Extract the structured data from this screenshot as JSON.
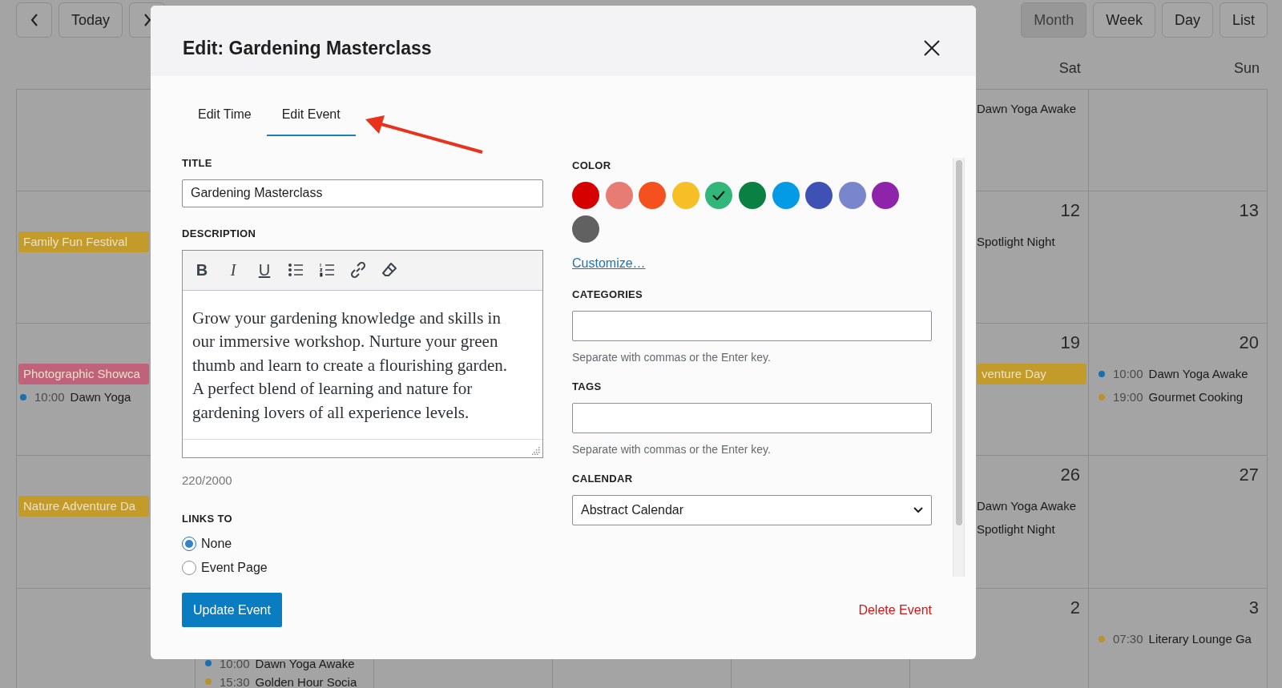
{
  "calendar": {
    "nav_buttons": [
      {
        "kind": "prev"
      },
      {
        "kind": "today",
        "label": "Today"
      },
      {
        "kind": "next"
      }
    ],
    "view_buttons": [
      {
        "label": "Month",
        "selected": true
      },
      {
        "label": "Week",
        "selected": false
      },
      {
        "label": "Day",
        "selected": false
      },
      {
        "label": "List",
        "selected": false
      }
    ],
    "weekday_headers": {
      "sat": "Sat",
      "sun": "Sun"
    },
    "weeks": [
      {
        "sat": {
          "items": [
            {
              "kind": "plain",
              "label": "Dawn Yoga Awake"
            }
          ]
        }
      },
      {
        "mon": {
          "items": [
            {
              "kind": "bar",
              "label": "Family Fun Festival",
              "color": "#c39b2a"
            }
          ]
        },
        "sat": {
          "date": "12",
          "items": [
            {
              "kind": "plain",
              "label": "Spotlight Night"
            }
          ]
        },
        "sun": {
          "date": "13"
        }
      },
      {
        "mon": {
          "items": [
            {
              "kind": "bar",
              "label": "Photographic Showca",
              "color": "#c0627c"
            },
            {
              "kind": "timed",
              "time": "10:00",
              "label": "Dawn Yoga",
              "color": "#1a6fb0"
            }
          ]
        },
        "sat": {
          "date": "19",
          "items": [
            {
              "kind": "bar",
              "label": "venture Day",
              "color": "#c39b2a"
            }
          ]
        },
        "sun": {
          "date": "20",
          "items": [
            {
              "kind": "timed",
              "time": "10:00",
              "label": "Dawn Yoga Awake",
              "color": "#1a6fb0"
            },
            {
              "kind": "timed",
              "time": "19:00",
              "label": "Gourmet Cooking",
              "color": "#b8922c"
            }
          ]
        }
      },
      {
        "mon": {
          "items": [
            {
              "kind": "bar",
              "label": "Nature Adventure Da",
              "color": "#c39b2a"
            }
          ]
        },
        "sat": {
          "date": "26",
          "items": [
            {
              "kind": "plain",
              "label": "Dawn Yoga Awake"
            },
            {
              "kind": "plain",
              "label": "Spotlight Night"
            }
          ]
        },
        "sun": {
          "date": "27"
        }
      },
      {
        "tue": {
          "items": [
            {
              "kind": "timed",
              "time": "10:00",
              "label": "Dawn Yoga Awake",
              "color": "#1a6fb0"
            },
            {
              "kind": "timed",
              "time": "15:30",
              "label": "Golden Hour Socia",
              "color": "#b8922c"
            }
          ]
        },
        "sat": {
          "date": "2"
        },
        "sun": {
          "date": "3",
          "items": [
            {
              "kind": "timed",
              "time": "07:30",
              "label": "Literary Lounge Ga",
              "color": "#b8922c"
            }
          ]
        }
      }
    ]
  },
  "modal": {
    "title": "Edit: Gardening Masterclass",
    "tabs": [
      {
        "label": "Edit Time",
        "selected": false
      },
      {
        "label": "Edit Event",
        "selected": true
      }
    ],
    "title_field": {
      "label": "TITLE",
      "value": "Gardening Masterclass"
    },
    "description": {
      "label": "DESCRIPTION",
      "toolbar": [
        {
          "kind": "bold",
          "glyph": "B"
        },
        {
          "kind": "italic",
          "glyph": "I"
        },
        {
          "kind": "underline",
          "glyph": "U"
        },
        {
          "kind": "bullet-list"
        },
        {
          "kind": "numbered-list"
        },
        {
          "kind": "link"
        },
        {
          "kind": "eraser"
        }
      ],
      "text": "Grow your gardening knowledge and skills in our immersive workshop. Nurture your green thumb and learn to create a flourishing garden. A perfect blend of learning and nature for gardening lovers of all experience levels.",
      "counter": "220/2000"
    },
    "links_to": {
      "label": "LINKS TO",
      "options": [
        {
          "label": "None",
          "selected": true
        },
        {
          "label": "Event Page",
          "selected": false
        }
      ]
    },
    "color": {
      "label": "COLOR",
      "swatches": [
        {
          "color": "#d50000",
          "selected": false
        },
        {
          "color": "#e67c73",
          "selected": false
        },
        {
          "color": "#f4511e",
          "selected": false
        },
        {
          "color": "#f6bf26",
          "selected": false
        },
        {
          "color": "#33b679",
          "selected": true
        },
        {
          "color": "#0b8043",
          "selected": false
        },
        {
          "color": "#039be5",
          "selected": false
        },
        {
          "color": "#3f51b5",
          "selected": false
        },
        {
          "color": "#7986cb",
          "selected": false
        },
        {
          "color": "#8e24aa",
          "selected": false
        },
        {
          "color": "#616161",
          "selected": false
        }
      ],
      "link": "Customize…"
    },
    "categories": {
      "label": "CATEGORIES",
      "hint": "Separate with commas or the Enter key."
    },
    "tags": {
      "label": "TAGS",
      "hint": "Separate with commas or the Enter key."
    },
    "calendar_select": {
      "label": "CALENDAR",
      "value": "Abstract Calendar"
    },
    "buttons": {
      "primary": "Update Event",
      "delete": "Delete Event"
    }
  }
}
